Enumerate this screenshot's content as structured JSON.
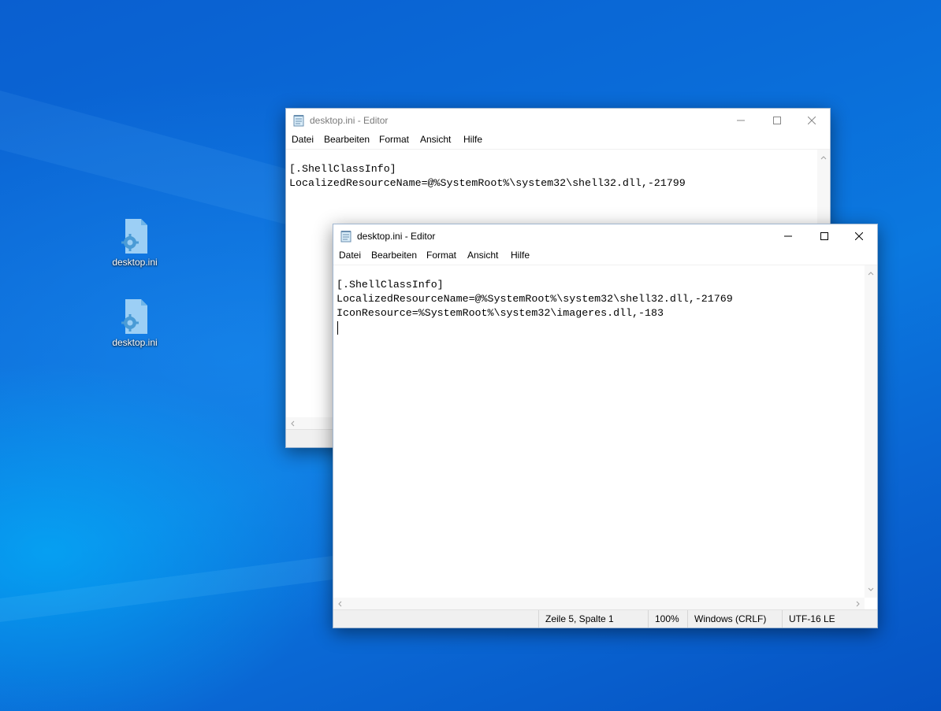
{
  "desktop": {
    "icons": [
      {
        "label": "desktop.ini",
        "icon": "settings-file-icon"
      },
      {
        "label": "desktop.ini",
        "icon": "settings-file-icon"
      }
    ]
  },
  "back_window": {
    "title": "desktop.ini - Editor",
    "menu": [
      "Datei",
      "Bearbeiten",
      "Format",
      "Ansicht",
      "Hilfe"
    ],
    "lines": [
      "[.ShellClassInfo]",
      "LocalizedResourceName=@%SystemRoot%\\system32\\shell32.dll,-21799"
    ]
  },
  "front_window": {
    "title": "desktop.ini - Editor",
    "menu": [
      "Datei",
      "Bearbeiten",
      "Format",
      "Ansicht",
      "Hilfe"
    ],
    "lines": [
      "[.ShellClassInfo]",
      "LocalizedResourceName=@%SystemRoot%\\system32\\shell32.dll,-21769",
      "IconResource=%SystemRoot%\\system32\\imageres.dll,-183"
    ],
    "status": {
      "position": "Zeile 5, Spalte 1",
      "zoom": "100%",
      "line_ending": "Windows (CRLF)",
      "encoding": "UTF-16 LE"
    }
  },
  "colors": {
    "wallpaper": "#0a6bd8",
    "window_border": "#9fb6d1",
    "statusbar": "#f0f0f0"
  }
}
